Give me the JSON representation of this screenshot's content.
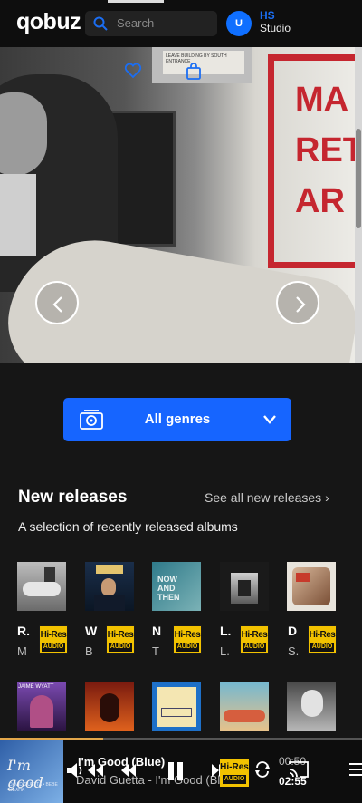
{
  "header": {
    "logo": "qobuz",
    "search_placeholder": "Search",
    "avatar_initial": "U",
    "studio_badge_top": "HS",
    "studio_badge_label": "Studio"
  },
  "hero": {
    "sign_text": "LEAVE BUILDING BY SOUTH ENTRANCE",
    "red_text_lines": [
      "MA",
      "RET",
      "AR"
    ]
  },
  "genres": {
    "label": "All genres"
  },
  "new_releases": {
    "title": "New releases",
    "see_all": "See all new releases ›",
    "description": "A selection of recently released albums",
    "row1": [
      {
        "initial": "R.",
        "artist": "M",
        "badge_top": "Hi-Res",
        "badge_bottom": "AUDIO"
      },
      {
        "initial": "W",
        "artist": "B",
        "badge_top": "Hi-Res",
        "badge_bottom": "AUDIO"
      },
      {
        "initial": "N",
        "artist": "T",
        "badge_top": "Hi-Res",
        "badge_bottom": "AUDIO"
      },
      {
        "initial": "L.",
        "artist": "L.",
        "badge_top": "Hi-Res",
        "badge_bottom": "AUDIO"
      },
      {
        "initial": "D",
        "artist": "S.",
        "badge_top": "Hi-Res",
        "badge_bottom": "AUDIO"
      }
    ],
    "row2_cover_texts": [
      "JAIME WYATT",
      "",
      "",
      "",
      ""
    ]
  },
  "player": {
    "progress_fraction": 0.285,
    "cover_title": "I'm good",
    "cover_subtitle": "DAVID GUETTA • BEBE REXHA",
    "title": "I'm Good (Blue)",
    "artist": "David Guetta - I'm Good (Blue)",
    "elapsed": "00:50",
    "duration": "02:55",
    "badge_top": "Hi-Res",
    "badge_bottom": "AUDIO"
  }
}
